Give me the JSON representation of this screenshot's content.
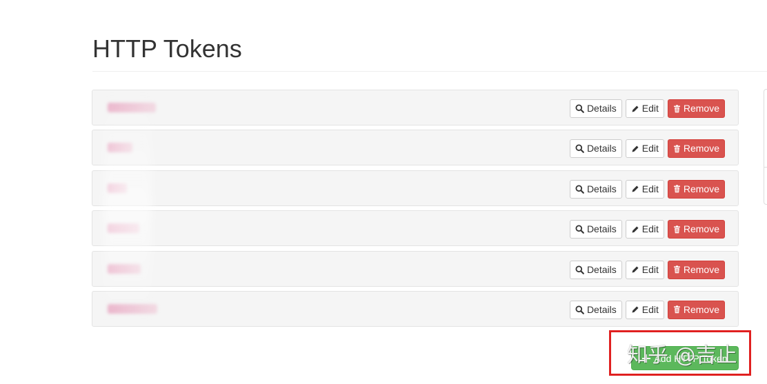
{
  "page": {
    "title": "HTTP Tokens"
  },
  "tokens": [
    {
      "name": "token-1",
      "details_label": "Details",
      "edit_label": "Edit",
      "remove_label": "Remove"
    },
    {
      "name": "tk2",
      "details_label": "Details",
      "edit_label": "Edit",
      "remove_label": "Remove"
    },
    {
      "name": "t3",
      "details_label": "Details",
      "edit_label": "Edit",
      "remove_label": "Remove"
    },
    {
      "name": "tok4",
      "details_label": "Details",
      "edit_label": "Edit",
      "remove_label": "Remove"
    },
    {
      "name": "tkn5",
      "details_label": "Details",
      "edit_label": "Edit",
      "remove_label": "Remove"
    },
    {
      "name": "token-six",
      "details_label": "Details",
      "edit_label": "Edit",
      "remove_label": "Remove"
    }
  ],
  "add_button": {
    "label": "Add HTTP Token",
    "icon": "plus-icon"
  },
  "watermark": {
    "text": "知乎 @吉止"
  },
  "icons": {
    "details": "search-icon",
    "edit": "pencil-icon",
    "remove": "trash-icon"
  },
  "colors": {
    "danger": "#d9534f",
    "success": "#5cb85c",
    "highlight_box": "#e02020",
    "row_background": "#f5f5f5"
  }
}
